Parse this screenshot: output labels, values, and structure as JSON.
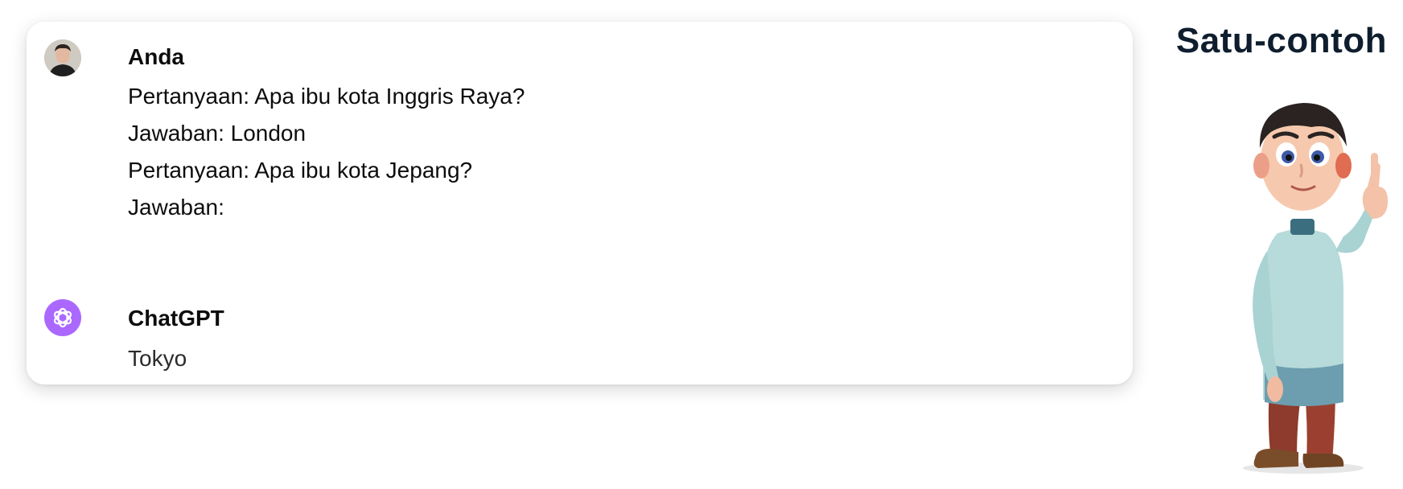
{
  "slide_title": "Satu-contoh",
  "conversation": {
    "user": {
      "name": "Anda",
      "lines": [
        "Pertanyaan: Apa ibu kota Inggris Raya?",
        "Jawaban: London",
        "Pertanyaan: Apa ibu kota Jepang?",
        "Jawaban:"
      ]
    },
    "assistant": {
      "name": "ChatGPT",
      "text": "Tokyo"
    }
  },
  "colors": {
    "assistant_avatar": "#ab68ff",
    "title_text": "#0f1e2e"
  },
  "icons": {
    "user_avatar": "user-avatar-photo",
    "assistant_avatar": "openai-logo-icon",
    "illustration": "cartoon-man-pointing-up"
  }
}
